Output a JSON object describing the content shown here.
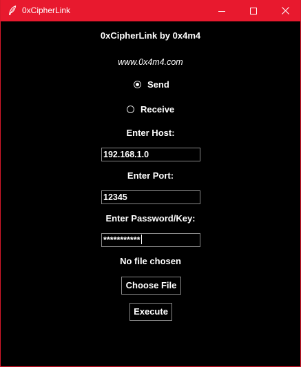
{
  "window": {
    "title": "0xCipherLink",
    "accent": "#e8192e"
  },
  "header": {
    "app_title": "0xCipherLink by 0x4m4",
    "website": "www.0x4m4.com"
  },
  "mode": {
    "send_label": "Send",
    "receive_label": "Receive",
    "selected": "Send"
  },
  "host": {
    "label": "Enter Host:",
    "value": "192.168.1.0"
  },
  "port": {
    "label": "Enter Port:",
    "value": "12345"
  },
  "password": {
    "label": "Enter Password/Key:",
    "value": "***********"
  },
  "file": {
    "status": "No file chosen",
    "choose_label": "Choose File"
  },
  "actions": {
    "execute_label": "Execute"
  }
}
